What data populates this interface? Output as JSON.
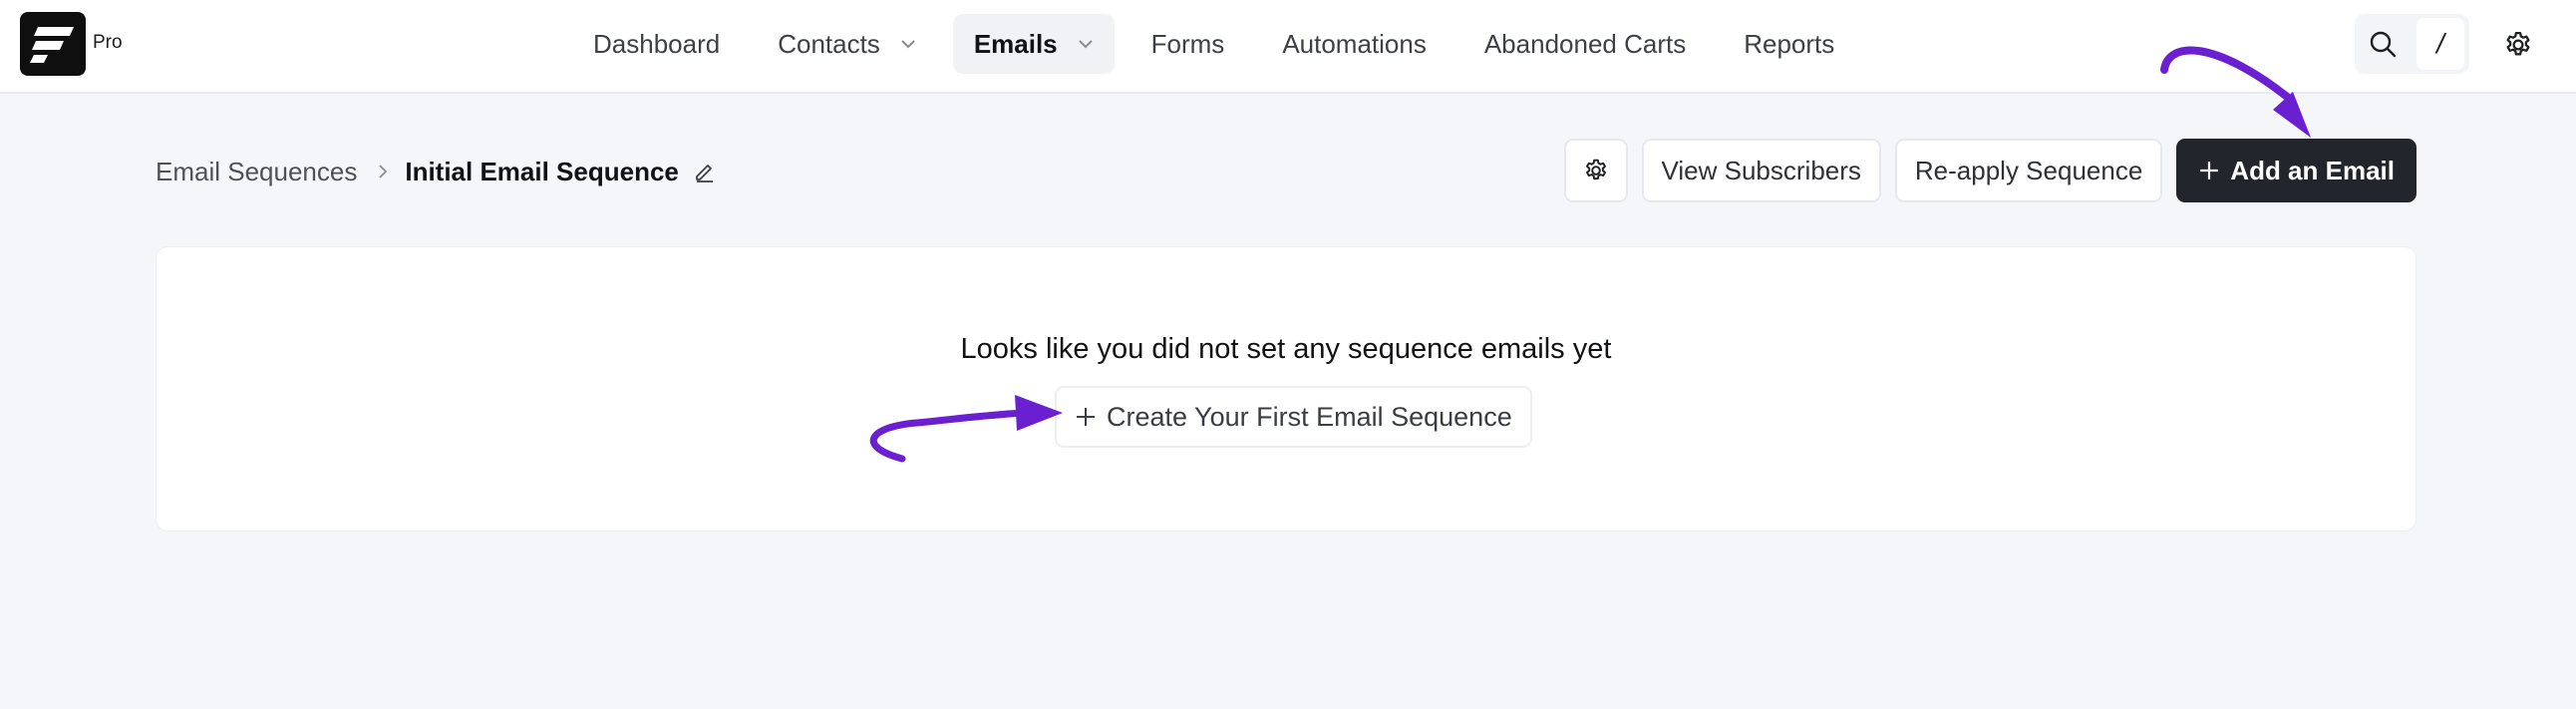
{
  "brand": {
    "badge": "Pro"
  },
  "nav": {
    "items": [
      {
        "label": "Dashboard",
        "dropdown": false,
        "active": false
      },
      {
        "label": "Contacts",
        "dropdown": true,
        "active": false
      },
      {
        "label": "Emails",
        "dropdown": true,
        "active": true
      },
      {
        "label": "Forms",
        "dropdown": false,
        "active": false
      },
      {
        "label": "Automations",
        "dropdown": false,
        "active": false
      },
      {
        "label": "Abandoned Carts",
        "dropdown": false,
        "active": false
      },
      {
        "label": "Reports",
        "dropdown": false,
        "active": false
      }
    ],
    "shortcut_key": "/"
  },
  "breadcrumb": {
    "parent": "Email Sequences",
    "current": "Initial Email Sequence"
  },
  "actions": {
    "view_subscribers": "View Subscribers",
    "reapply": "Re-apply Sequence",
    "add_email": "Add an Email"
  },
  "empty_state": {
    "message": "Looks like you did not set any sequence emails yet",
    "create_label": "Create Your First Email Sequence"
  },
  "colors": {
    "primary": "#23252c",
    "annotation": "#6a1fd1",
    "background": "#f5f6fa"
  }
}
